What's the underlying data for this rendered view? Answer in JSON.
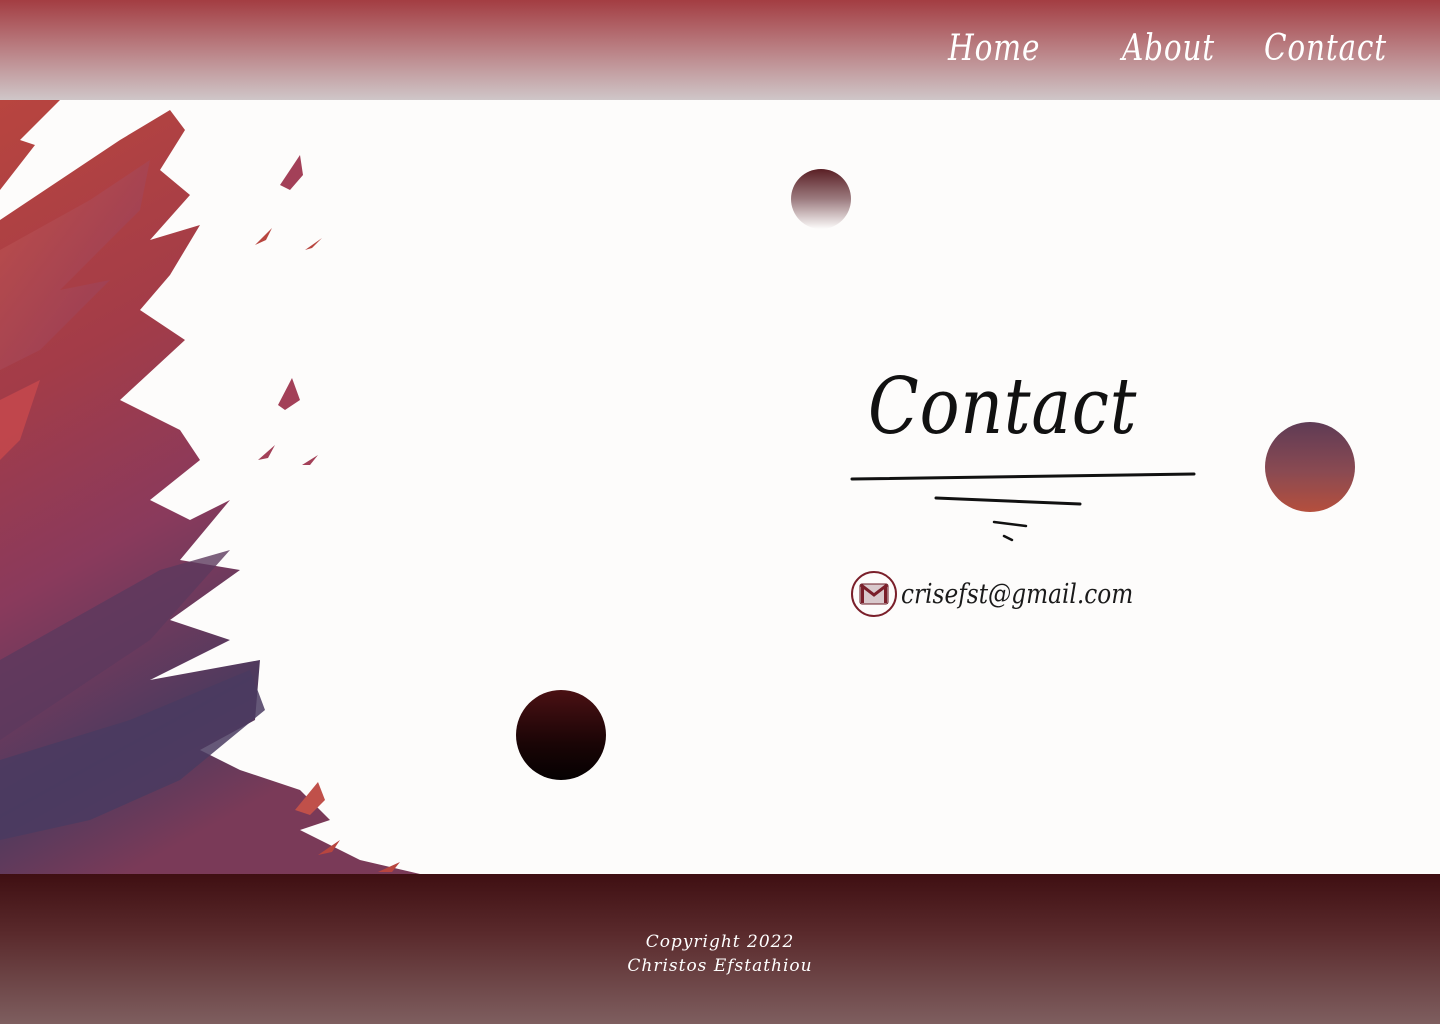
{
  "nav": {
    "items": [
      {
        "label": "Home"
      },
      {
        "label": "About"
      },
      {
        "label": "Contact"
      }
    ]
  },
  "main": {
    "title": "Contact",
    "email": "crisefst@gmail.com",
    "email_icon": "mail-icon"
  },
  "footer": {
    "line1": "Copyright 2022",
    "line2": "Christos Efstathiou"
  },
  "colors": {
    "header_top": "#a33d42",
    "header_bottom": "#cfc6c8",
    "footer_top": "#3f0f12",
    "footer_bottom": "#7e5e5f",
    "background": "#fdfcfb",
    "accent": "#7a1f2a"
  }
}
